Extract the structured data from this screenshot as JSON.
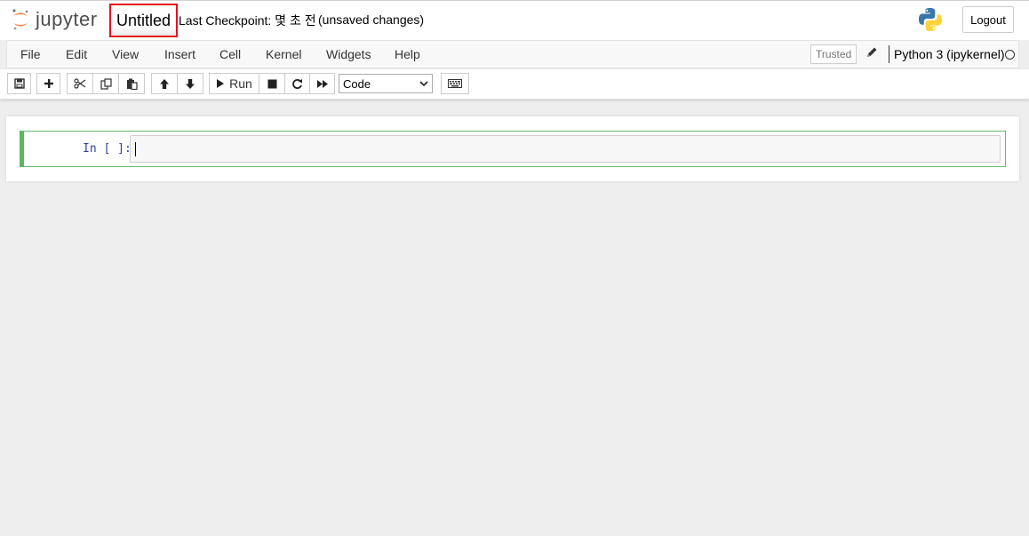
{
  "header": {
    "logo_text": "jupyter",
    "notebook_name": "Untitled",
    "checkpoint": "Last Checkpoint: 몇 초 전",
    "autosave_status": "(unsaved changes)",
    "logout_label": "Logout"
  },
  "menubar": {
    "items": [
      "File",
      "Edit",
      "View",
      "Insert",
      "Cell",
      "Kernel",
      "Widgets",
      "Help"
    ],
    "trusted_label": "Trusted",
    "kernel_name": "Python 3 (ipykernel)"
  },
  "toolbar": {
    "run_label": "Run",
    "cell_type": "Code",
    "icons": [
      "save-icon",
      "plus-icon",
      "cut-icon",
      "copy-icon",
      "paste-icon",
      "arrow-up-icon",
      "arrow-down-icon",
      "play-icon",
      "stop-icon",
      "restart-icon",
      "fast-forward-icon",
      "keyboard-icon"
    ]
  },
  "cell": {
    "prompt": "In [ ]:",
    "source": ""
  },
  "colors": {
    "accent_green": "#5cb85c",
    "highlight_red": "#e0141e",
    "logo_orange": "#f37726",
    "prompt_blue": "#303f9f"
  }
}
